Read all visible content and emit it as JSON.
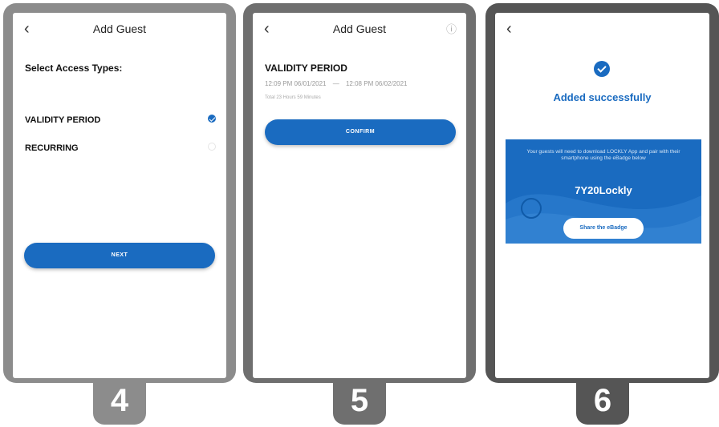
{
  "steps": [
    {
      "number": "4",
      "header": {
        "title": "Add Guest",
        "back_icon": "‹"
      },
      "heading": "Select Access Types:",
      "options": [
        {
          "label": "VALIDITY PERIOD",
          "selected": true
        },
        {
          "label": "RECURRING",
          "selected": false
        }
      ],
      "button": "NEXT"
    },
    {
      "number": "5",
      "header": {
        "title": "Add Guest",
        "back_icon": "‹",
        "info_icon": "ⓘ"
      },
      "section_title": "VALIDITY PERIOD",
      "start": "12:09 PM 06/01/2021",
      "separator": "—",
      "end": "12:08 PM 06/02/2021",
      "total": "Total 23 Hours 59 Minutes",
      "button": "CONFIRM"
    },
    {
      "number": "6",
      "header": {
        "back_icon": "‹"
      },
      "success_text": "Added successfully",
      "card": {
        "message": "Your guests will need to download LOCKLY App and pair with their smartphone using the eBadge below",
        "code": "7Y20Lockly",
        "share_button": "Share the eBadge"
      }
    }
  ],
  "colors": {
    "frame4": "#8c8c8c",
    "frame5": "#6f6f6f",
    "frame6": "#555555",
    "primary": "#1a6bc0"
  }
}
